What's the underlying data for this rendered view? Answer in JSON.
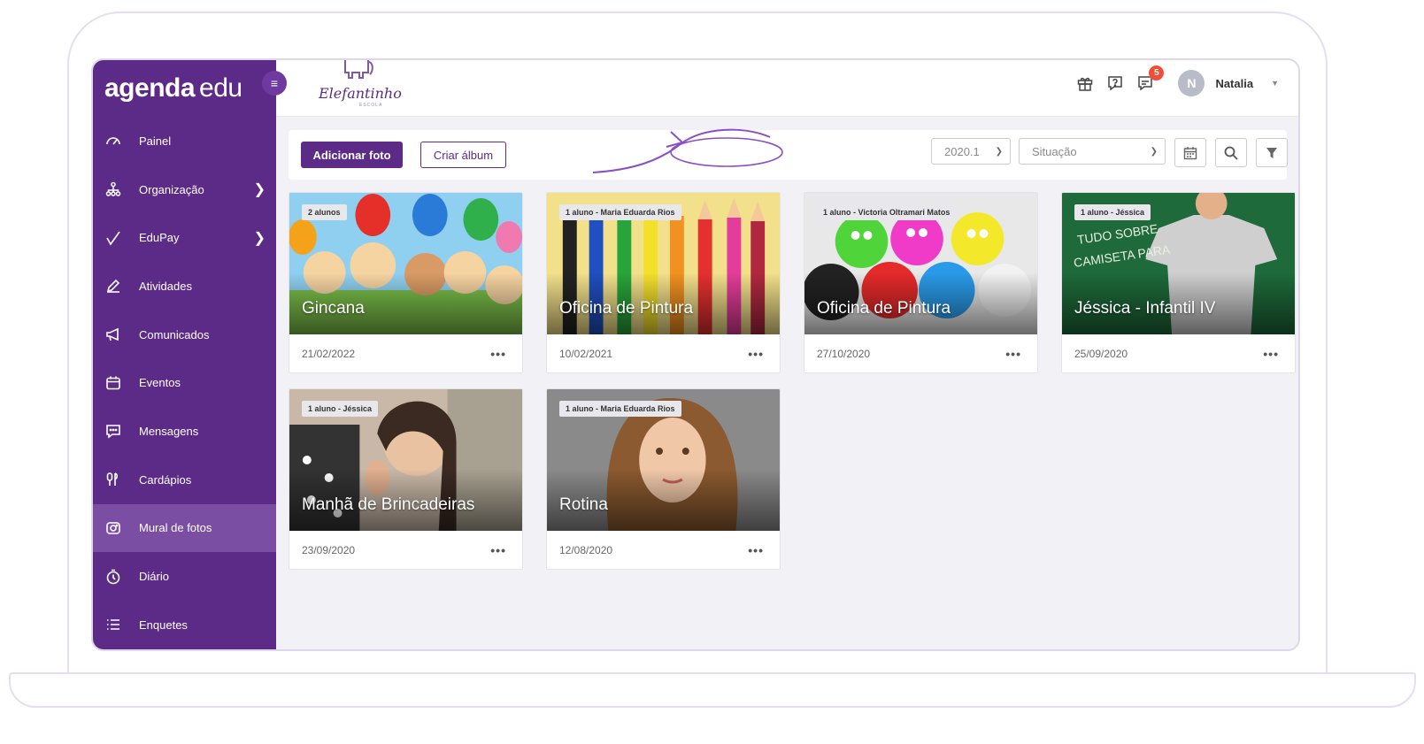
{
  "brand": {
    "bold": "agenda",
    "light": "edu"
  },
  "school": {
    "name": "Elefantinho",
    "sub": "ESCOLA"
  },
  "sidebar": {
    "items": [
      {
        "label": "Painel",
        "icon": "dashboard-icon"
      },
      {
        "label": "Organização",
        "icon": "org-chart-icon"
      },
      {
        "label": "EduPay",
        "icon": "pay-check-icon"
      },
      {
        "label": "Atividades",
        "icon": "pencil-icon"
      },
      {
        "label": "Comunicados",
        "icon": "megaphone-icon"
      },
      {
        "label": "Eventos",
        "icon": "calendar-icon"
      },
      {
        "label": "Mensagens",
        "icon": "chat-icon"
      },
      {
        "label": "Cardápios",
        "icon": "utensils-icon"
      },
      {
        "label": "Mural de fotos",
        "icon": "camera-icon"
      },
      {
        "label": "Diário",
        "icon": "clock-icon"
      },
      {
        "label": "Enquetes",
        "icon": "list-icon"
      }
    ]
  },
  "header": {
    "notifications_count": "5",
    "avatar_initial": "N",
    "username": "Natalia"
  },
  "toolbar": {
    "add_photo": "Adicionar foto",
    "create_album": "Criar álbum",
    "period_value": "2020.1",
    "status_placeholder": "Situação"
  },
  "cards": [
    {
      "tag": "2 alunos",
      "title": "Gincana",
      "date": "21/02/2022"
    },
    {
      "tag": "1 aluno - Maria Eduarda Rios",
      "title": "Oficina de Pintura",
      "date": "10/02/2021"
    },
    {
      "tag": "1 aluno - Victoria Oltramari Matos",
      "title": "Oficina de Pintura",
      "date": "27/10/2020"
    },
    {
      "tag": "1 aluno - Jéssica",
      "title": "Jéssica - Infantil IV",
      "date": "25/09/2020"
    },
    {
      "tag": "1 aluno - Jéssica",
      "title": "Manhã de Brincadeiras",
      "date": "23/09/2020"
    },
    {
      "tag": "1 aluno - Maria Eduarda Rios",
      "title": "Rotina",
      "date": "12/08/2020"
    }
  ],
  "colors": {
    "primary": "#5b2b87",
    "badge": "#f04e37"
  }
}
